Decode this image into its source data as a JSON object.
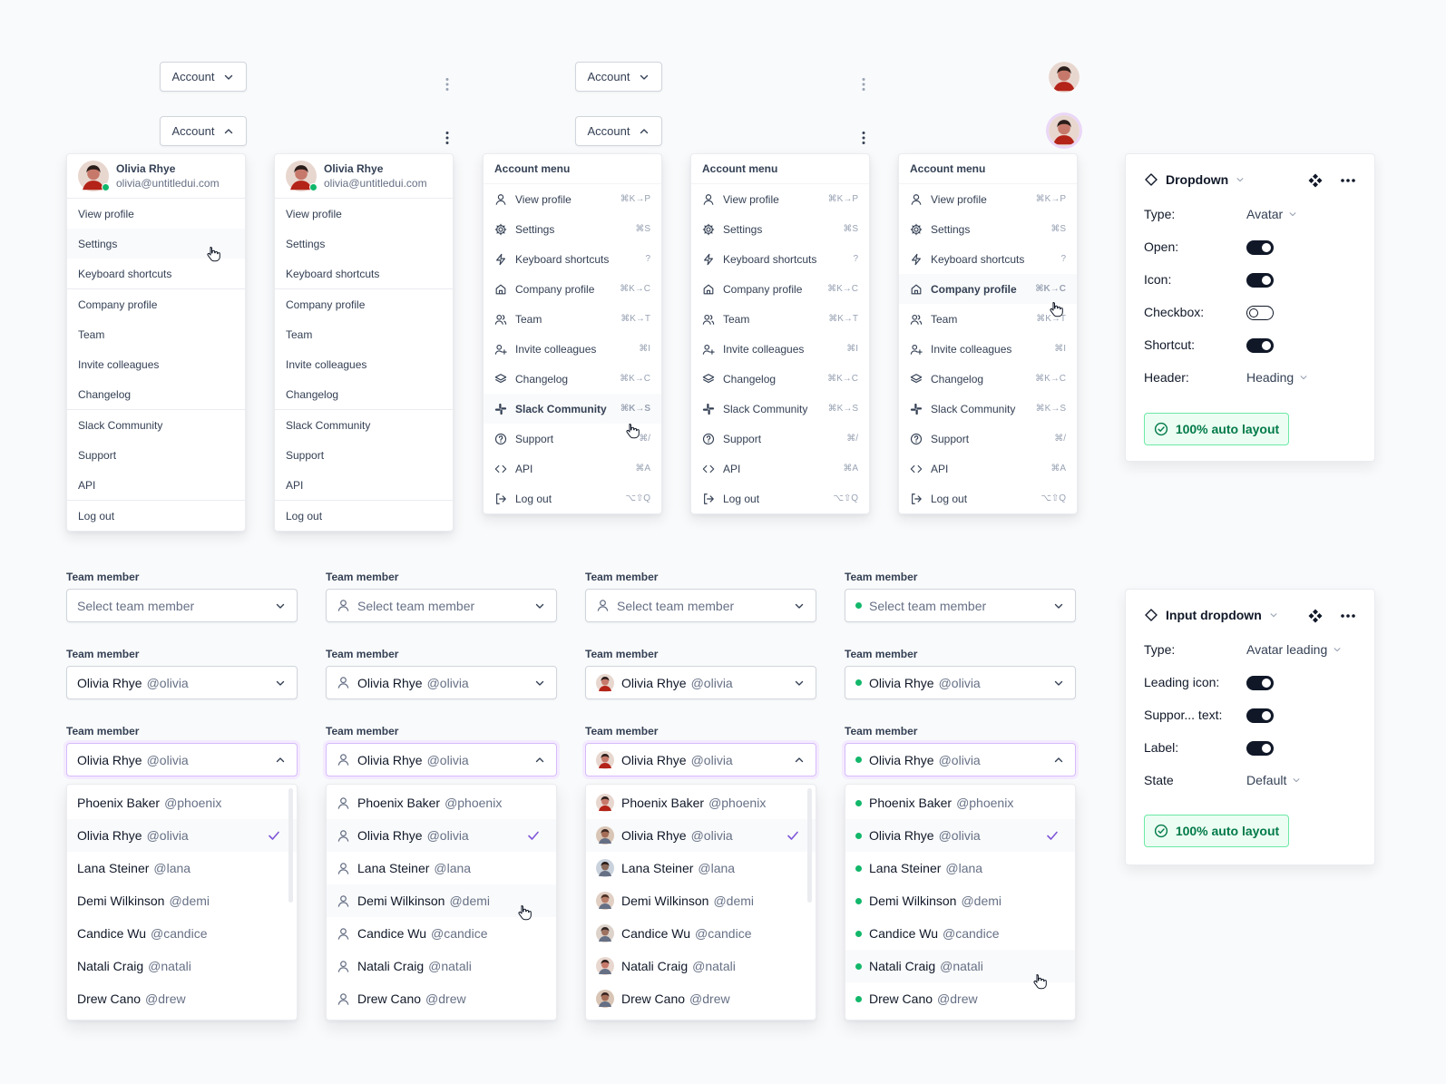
{
  "account_button_label": "Account",
  "user": {
    "name": "Olivia Rhye",
    "email": "olivia@untitledui.com"
  },
  "menu_title": "Account menu",
  "text_menu_items": [
    "View profile",
    "Settings",
    "Keyboard shortcuts",
    "Company profile",
    "Team",
    "Invite colleagues",
    "Changelog",
    "Slack Community",
    "Support",
    "API",
    "Log out"
  ],
  "icon_menu_items": [
    {
      "label": "View profile",
      "icon": "user-icon",
      "shortcut": "⌘K→P"
    },
    {
      "label": "Settings",
      "icon": "settings-icon",
      "shortcut": "⌘S"
    },
    {
      "label": "Keyboard shortcuts",
      "icon": "lightning-icon",
      "shortcut": "?"
    },
    {
      "label": "Company profile",
      "icon": "home-icon",
      "shortcut": "⌘K→C"
    },
    {
      "label": "Team",
      "icon": "users-icon",
      "shortcut": "⌘K→T"
    },
    {
      "label": "Invite colleagues",
      "icon": "user-plus-icon",
      "shortcut": "⌘I"
    },
    {
      "label": "Changelog",
      "icon": "layers-icon",
      "shortcut": "⌘K→C"
    },
    {
      "label": "Slack Community",
      "icon": "slack-icon",
      "shortcut": "⌘K→S"
    },
    {
      "label": "Support",
      "icon": "help-circle-icon",
      "shortcut": "⌘/"
    },
    {
      "label": "API",
      "icon": "code-icon",
      "shortcut": "⌘A"
    },
    {
      "label": "Log out",
      "icon": "log-out-icon",
      "shortcut": "⌥⇧Q"
    }
  ],
  "field_label": "Team member",
  "placeholder": "Select team member",
  "selected": {
    "name": "Olivia Rhye",
    "handle": "@olivia"
  },
  "members": [
    {
      "name": "Phoenix Baker",
      "handle": "@phoenix"
    },
    {
      "name": "Olivia Rhye",
      "handle": "@olivia"
    },
    {
      "name": "Lana Steiner",
      "handle": "@lana"
    },
    {
      "name": "Demi Wilkinson",
      "handle": "@demi"
    },
    {
      "name": "Candice Wu",
      "handle": "@candice"
    },
    {
      "name": "Natali Craig",
      "handle": "@natali"
    },
    {
      "name": "Drew Cano",
      "handle": "@drew"
    }
  ],
  "panel1": {
    "title": "Dropdown",
    "rows": [
      {
        "label": "Type:",
        "kind": "select",
        "value": "Avatar"
      },
      {
        "label": "Open:",
        "kind": "toggle",
        "value": true
      },
      {
        "label": "Icon:",
        "kind": "toggle",
        "value": true
      },
      {
        "label": "Checkbox:",
        "kind": "toggle",
        "value": false
      },
      {
        "label": "Shortcut:",
        "kind": "toggle",
        "value": true
      },
      {
        "label": "Header:",
        "kind": "select",
        "value": "Heading"
      }
    ],
    "button": "100% auto layout"
  },
  "panel2": {
    "title": "Input dropdown",
    "rows": [
      {
        "label": "Type:",
        "kind": "select",
        "value": "Avatar leading"
      },
      {
        "label": "Leading icon:",
        "kind": "toggle",
        "value": true
      },
      {
        "label": "Suppor... text:",
        "kind": "toggle",
        "value": true
      },
      {
        "label": "Label:",
        "kind": "toggle",
        "value": true
      },
      {
        "label": "State",
        "kind": "select",
        "value": "Default"
      }
    ],
    "button": "100% auto layout"
  },
  "colors": {
    "accent_focus": "#d6bbfb",
    "online": "#12b76a",
    "success_text": "#027a48"
  }
}
